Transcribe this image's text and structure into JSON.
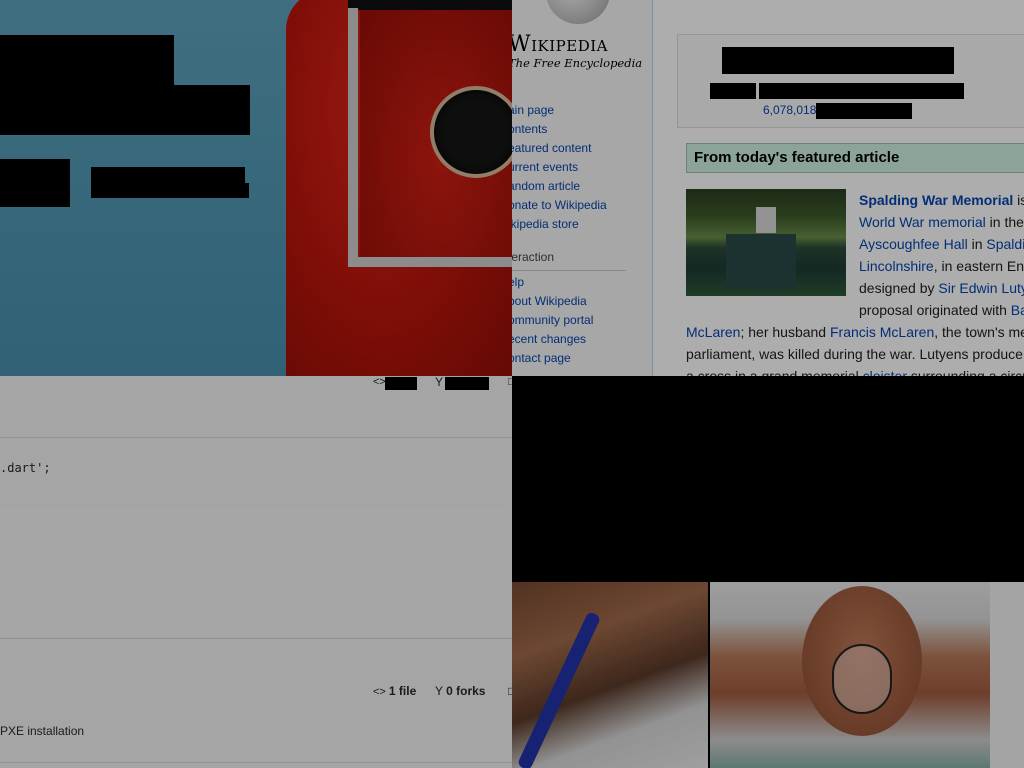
{
  "wikipedia": {
    "wordmark": "Wikipedia",
    "tagline": "The Free Encyclopedia",
    "nav_main": [
      "ain page",
      "ontents",
      "eatured content",
      "urrent events",
      "andom article",
      "onate to Wikipedia",
      "ikipedia store"
    ],
    "nav_interaction_heading": "teraction",
    "nav_interaction": [
      "elp",
      "bout Wikipedia",
      "ommunity portal",
      "ecent changes",
      "ontact page"
    ],
    "article_count": "6,078,018",
    "featured_heading": "From today's featured article",
    "featured": {
      "l1_link": "Spalding War Memorial",
      "l1_tail": " is",
      "l2_link": "World War memorial",
      "l2_tail": " in the",
      "l3_link": "Ayscoughfee Hall",
      "l3_mid": " in ",
      "l3_link2": "Spaldi",
      "l4_link": "Lincolnshire",
      "l4_tail": ", in eastern En",
      "l5_head": "designed by ",
      "l5_link": "Sir Edwin Luty",
      "l6_head": "proposal originated with ",
      "l6_link": "Ba",
      "l7_link": "McLaren",
      "l7_mid": "; her husband ",
      "l7_link2": "Francis McLaren",
      "l7_tail": ", the town's me",
      "l8": "parliament, was killed during the war. Lutyens produce",
      "l9_head": "a cross in a grand memorial ",
      "l9_link": "cloister",
      "l9_tail": " surrounding a circu"
    }
  },
  "gist": {
    "code_line": ".dart';",
    "files_count": "1 file",
    "forks_count": "0 forks",
    "description": "PXE installation"
  },
  "colors": {
    "link": "#0645ad",
    "featured_bg": "#cef2e0",
    "ad_background": "#5fa3bd",
    "ad_red": "#c0180e"
  }
}
